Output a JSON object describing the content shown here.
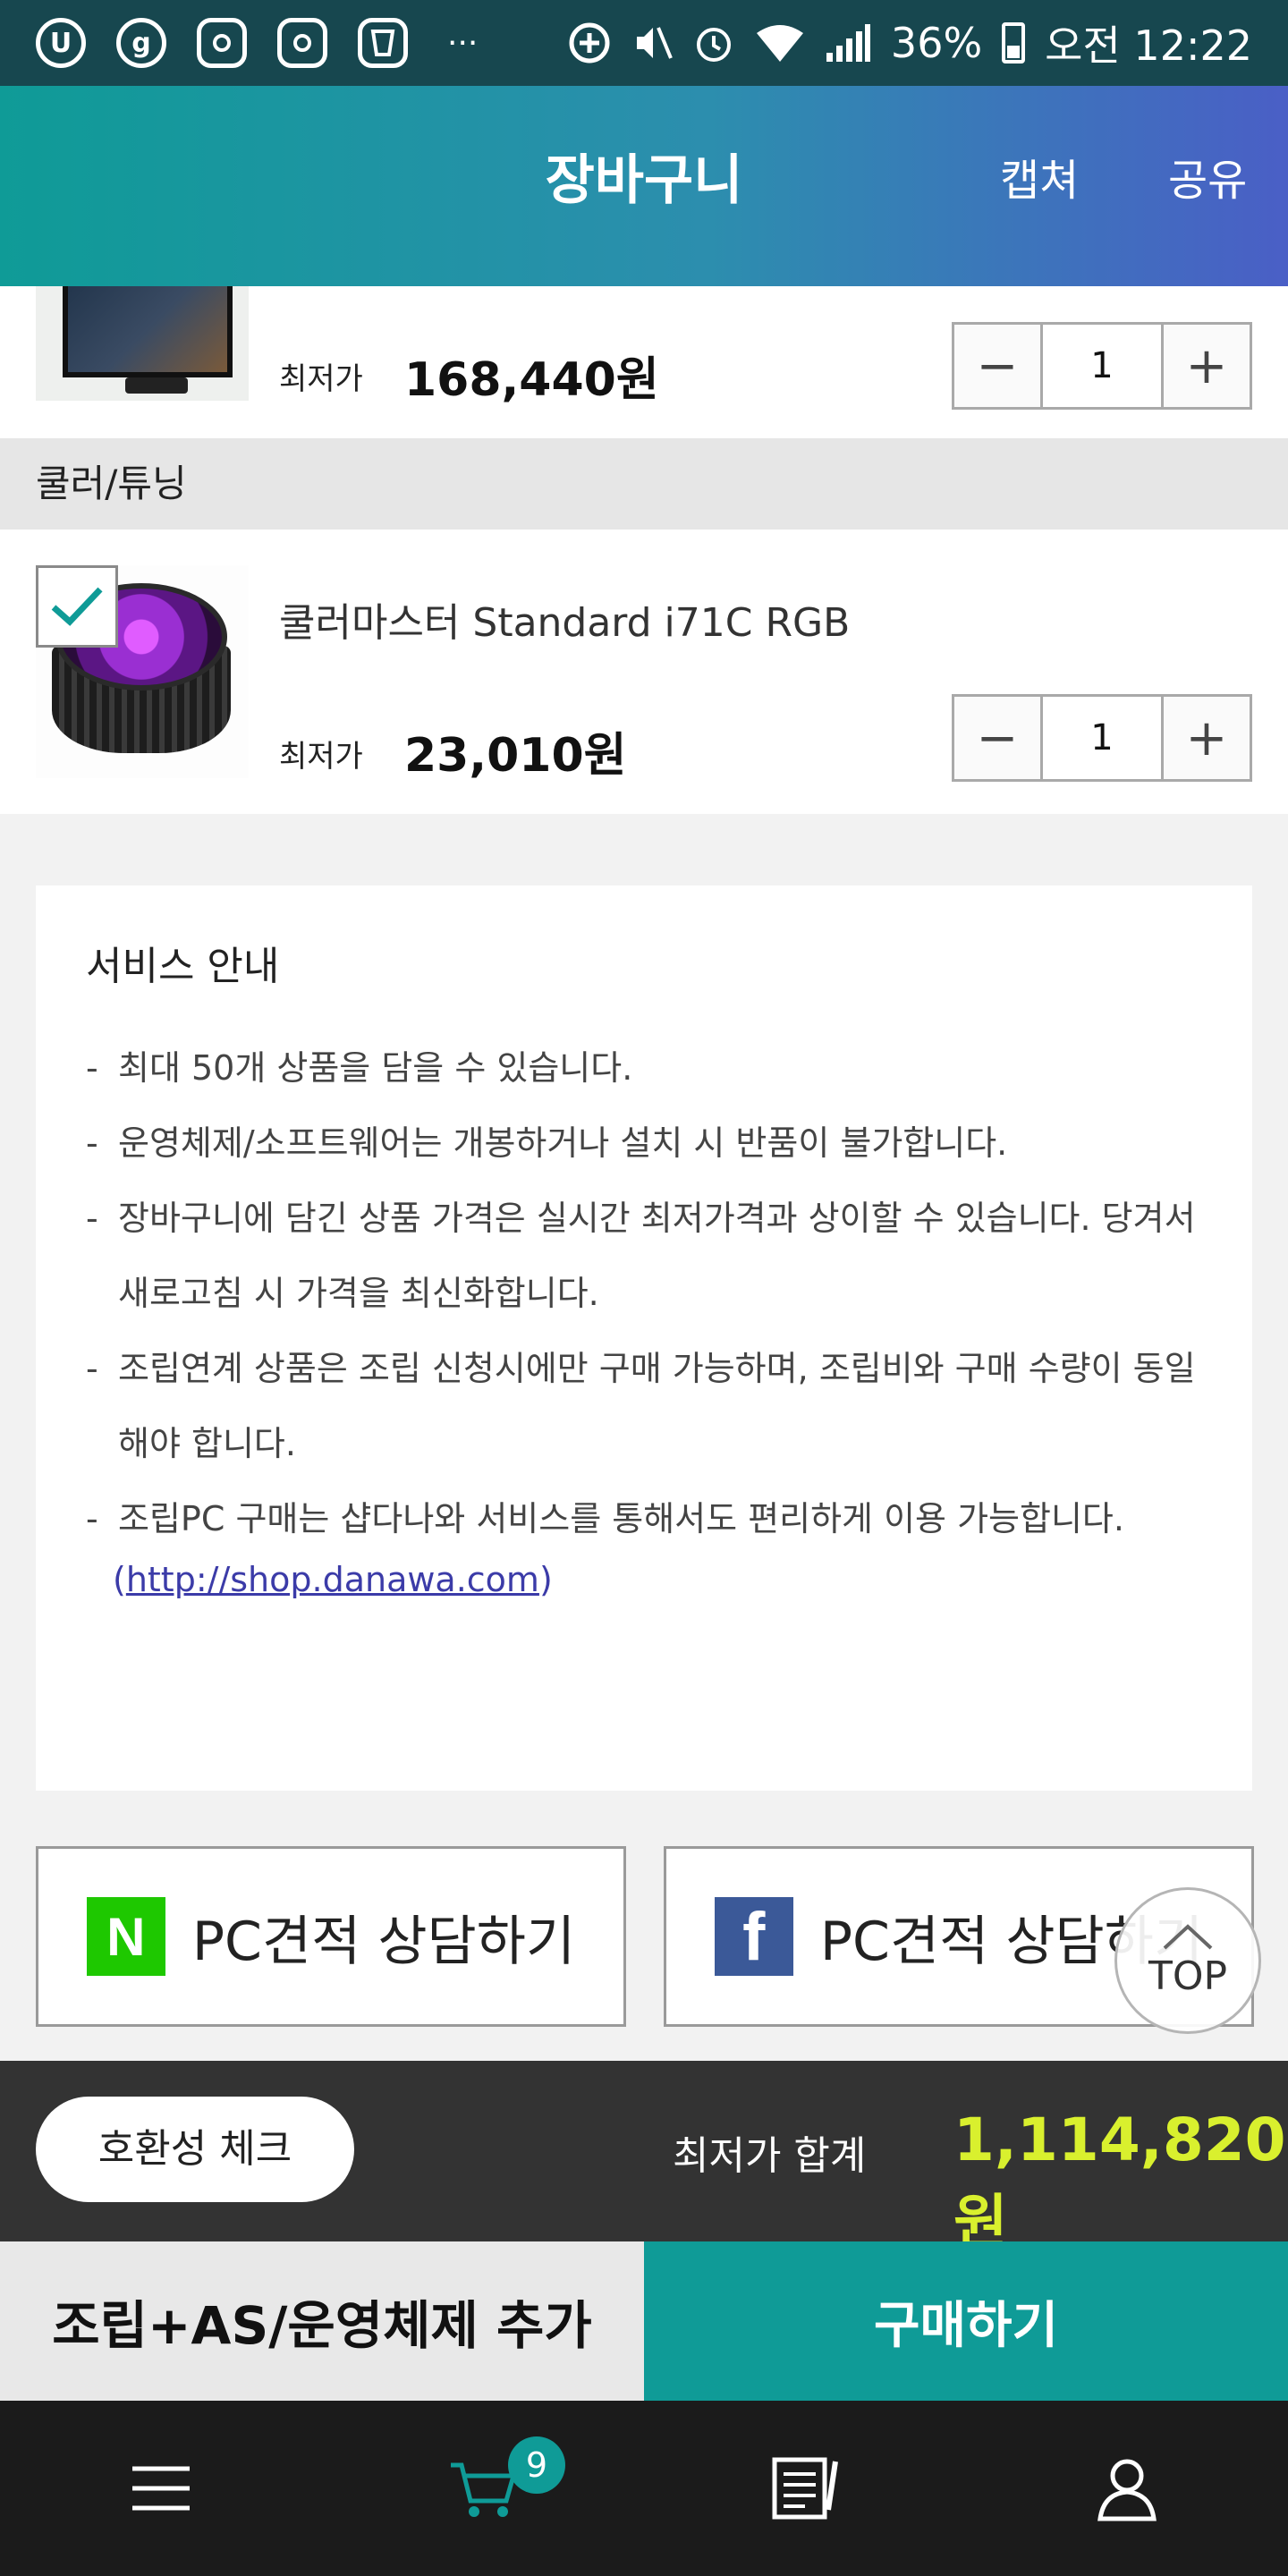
{
  "status_bar": {
    "app_icons": [
      "U",
      "g",
      "insta-1",
      "insta-2",
      "cup"
    ],
    "more": "···",
    "battery": "36%",
    "time": "오전 12:22"
  },
  "header": {
    "title": "장바구니",
    "capture_label": "캡쳐",
    "share_label": "공유"
  },
  "products": [
    {
      "price_label": "최저가",
      "price": "168,440원",
      "quantity": "1"
    },
    {
      "name": "쿨러마스터 Standard i71C RGB",
      "price_label": "최저가",
      "price": "23,010원",
      "quantity": "1",
      "checked": true
    }
  ],
  "category": "쿨러/튜닝",
  "stepper": {
    "minus": "−",
    "plus": "+"
  },
  "notice": {
    "title": "서비스 안내",
    "items": [
      "최대 50개 상품을 담을 수 있습니다.",
      "운영체제/소프트웨어는 개봉하거나 설치 시 반품이 불가합니다.",
      "장바구니에 담긴 상품 가격은 실시간 최저가격과 상이할 수 있습니다. 당겨서 새로고침 시 가격을 최신화합니다.",
      "조립연계 상품은 조립 신청시에만 구매 가능하며, 조립비와 구매 수량이 동일해야 합니다.",
      "조립PC 구매는 샵다나와 서비스를 통해서도 편리하게 이용 가능합니다."
    ],
    "link_open": "(",
    "link_url": "http://shop.danawa.com",
    "link_close": ")"
  },
  "consult": {
    "naver_logo": "N",
    "naver_label": "PC견적 상담하기",
    "facebook_logo": "f",
    "facebook_label": "PC견적 상담하기"
  },
  "top_button": "TOP",
  "summary": {
    "compat_label": "호환성 체크",
    "total_label": "최저가 합계",
    "total_value": "1,114,820원"
  },
  "actions": {
    "addon_label": "조립+AS/운영체제 추가",
    "buy_label": "구매하기"
  },
  "bottom_nav": {
    "cart_count": "9"
  },
  "colors": {
    "teal": "#0f9b97",
    "total_highlight": "#d9f02e",
    "naver_green": "#1ec800",
    "facebook_blue": "#3b5998"
  }
}
